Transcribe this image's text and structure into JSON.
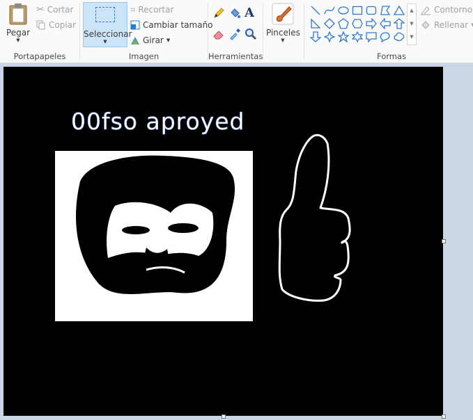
{
  "ribbon": {
    "clipboard": {
      "paste": "Pegar",
      "cut": "Cortar",
      "copy": "Copiar",
      "group": "Portapapeles"
    },
    "image": {
      "select": "Seleccionar",
      "crop": "Recortar",
      "resize": "Cambiar tamaño",
      "rotate": "Girar",
      "group": "Imagen"
    },
    "tools": {
      "group": "Herramientas"
    },
    "brushes": {
      "label": "Pinceles"
    },
    "shapes": {
      "outline": "Contorno",
      "fill": "Rellenar",
      "group": "Formas"
    }
  },
  "canvas": {
    "caption": "00fso aproyed"
  },
  "colors": {
    "accent": "#2b79d0",
    "select_bg": "#cce4f7",
    "workspace": "#cad5e5",
    "canvas": "#000000"
  }
}
